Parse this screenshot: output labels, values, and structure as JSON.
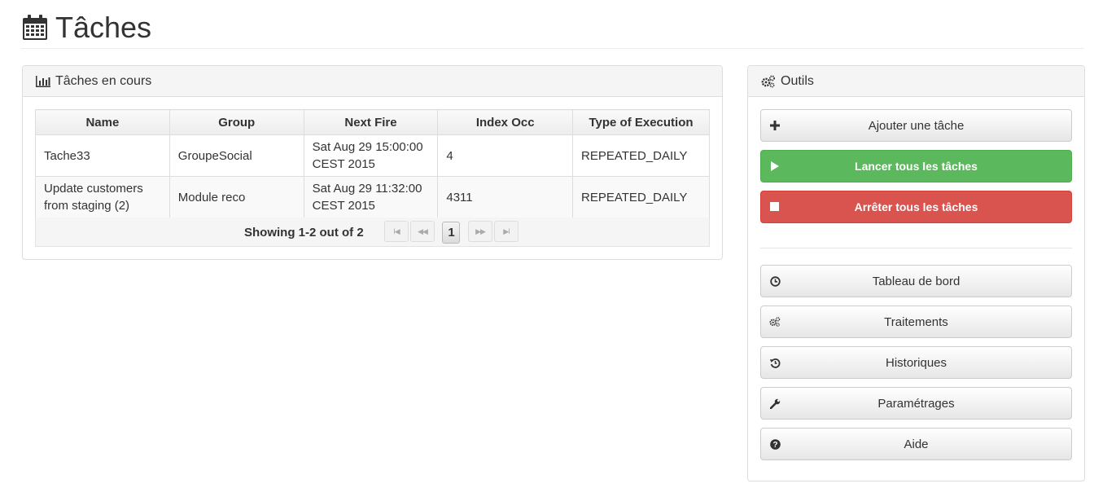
{
  "header": {
    "title": "Tâches"
  },
  "tasks_panel": {
    "title": "Tâches en cours",
    "columns": [
      "Name",
      "Group",
      "Next Fire",
      "Index Occ",
      "Type of Execution"
    ],
    "rows": [
      {
        "name": "Tache33",
        "group": "GroupeSocial",
        "next_fire_1": "Sat Aug 29 15:00:00",
        "next_fire_2": "CEST 2015",
        "index": "4",
        "type": "REPEATED_DAILY"
      },
      {
        "name_1": "Update customers",
        "name_2": "from staging (2)",
        "group": "Module reco",
        "next_fire_1": "Sat Aug 29 11:32:00",
        "next_fire_2": "CEST 2015",
        "index": "4311",
        "type": "REPEATED_DAILY"
      }
    ],
    "pager": {
      "summary": "Showing 1-2 out of 2",
      "current_page": "1",
      "first": "I◀",
      "prev": "◀◀",
      "next": "▶▶",
      "last": "▶I"
    }
  },
  "tools_panel": {
    "title": "Outils",
    "add": "Ajouter une tâche",
    "start_all": "Lancer tous les tâches",
    "stop_all": "Arrêter tous les tâches",
    "dashboard": "Tableau de bord",
    "processing": "Traitements",
    "history": "Historiques",
    "settings": "Paramétrages",
    "help": "Aide"
  },
  "colors": {
    "success": "#5cb85c",
    "danger": "#d9534f",
    "panel_heading": "#f5f5f5"
  },
  "icons": [
    "calendar-icon",
    "bar-chart-icon",
    "cogs-icon",
    "plus-icon",
    "play-icon",
    "stop-icon",
    "dashboard-icon",
    "history-icon",
    "wrench-icon",
    "question-icon"
  ]
}
